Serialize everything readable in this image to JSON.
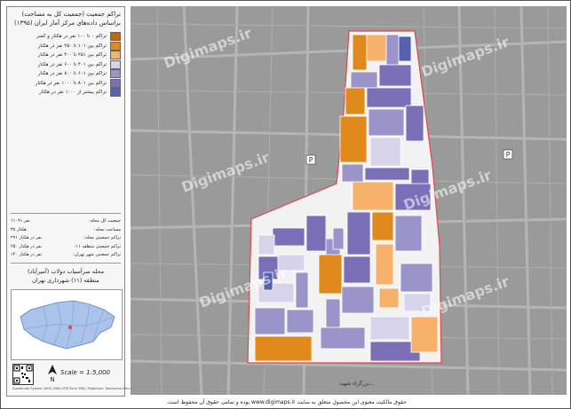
{
  "panel": {
    "title_line1": "تراکم جمعیت (جمعیت کل به مساحت)",
    "title_line2": "براساس داده‌های مرکز آمار ایران (۱۳۹۵)"
  },
  "legend": [
    {
      "label": "تراکم ۰ تا ۱۰۰ نفر در هکتار و کمتر",
      "color": "#c8660e"
    },
    {
      "label": "تراکم بین ۱۰۱ تا ۲۵۰ نفر در هکتار",
      "color": "#e08a1e"
    },
    {
      "label": "تراکم بین ۲۵۱ تا ۴۰۰ نفر در هکتار",
      "color": "#f6b26b"
    },
    {
      "label": "تراکم بین ۴۰۱ تا ۶۰۰ نفر در هکتار",
      "color": "#d6d3ea"
    },
    {
      "label": "تراکم بین ۶۰۱ تا ۸۰۰ نفر در هکتار",
      "color": "#9b94c9"
    },
    {
      "label": "تراکم بین ۸۰۱ تا ۱۰۰۰ نفر در هکتار",
      "color": "#7b6fb8"
    },
    {
      "label": "تراکم بیشتر از ۱۰۰۰ نفر در هکتار",
      "color": "#5562b0"
    }
  ],
  "stats": [
    {
      "label": "جمعیت کل محله:",
      "value": "۱۱۰۹۱ نفر"
    },
    {
      "label": "مساحت محله:",
      "value": "۳۸ هکتار"
    },
    {
      "label": "تراکم جمعیتی محله:",
      "value": "۲۹۱ نفر در هکتار"
    },
    {
      "label": "تراکم جمعیتی منطقه ۱۱:",
      "value": "۲۵۰ نفر در هکتار"
    },
    {
      "label": "تراکم جمعیتی شهر تهران:",
      "value": "۱۴۰ نفر در هکتار"
    }
  ],
  "area": {
    "line1": "محله سرآسیاب دولاب (آمیرآباد)",
    "line2": "منطقه (۱۱) شهرداری تهران"
  },
  "scale": {
    "text": "Scale = 1:5,000"
  },
  "north_label": "N",
  "footer_small": "Coordinate System: WGS 1984 UTM Zone 39N | Projection: Transverse Mercator",
  "bottom_bar": "حقوق مالکیت معنوی این محصول متعلق به سایت www.digimaps.ir بوده و تمامی حقوق آن محفوظ است.",
  "watermarks": [
    "Digimaps.ir",
    "Digimaps.ir",
    "Digimaps.ir",
    "Digimaps.ir",
    "Digimaps.ir",
    "Digimaps.ir"
  ],
  "map_labels": {
    "street_bottom": "بزرگراه شهید...",
    "poi_p": "P"
  }
}
